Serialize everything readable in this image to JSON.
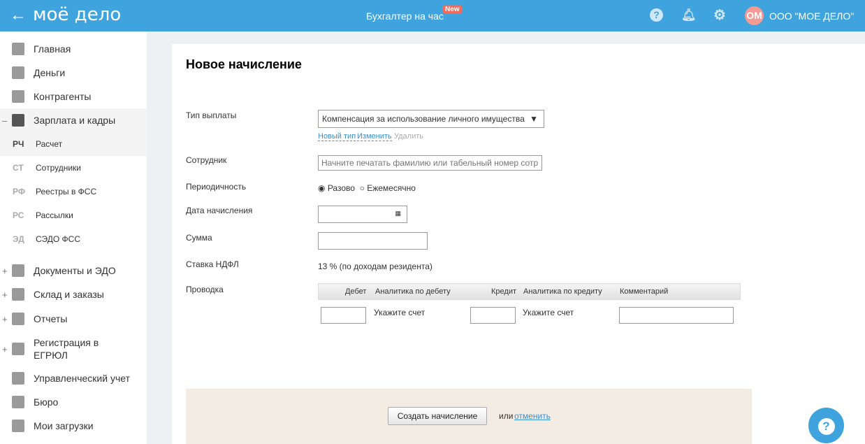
{
  "header": {
    "back": "←",
    "logo": "моё дело",
    "center_link": "Бухгалтер на час",
    "new_badge": "New",
    "avatar": "ОМ",
    "org": "ООО \"МОЕ ДЕЛО\""
  },
  "sidebar": {
    "items": [
      {
        "label": "Главная"
      },
      {
        "label": "Деньги"
      },
      {
        "label": "Контрагенты"
      },
      {
        "label": "Зарплата и кадры",
        "toggle": "–"
      }
    ],
    "sub": [
      {
        "abbr": "РЧ",
        "label": "Расчет"
      },
      {
        "abbr": "СТ",
        "label": "Сотрудники"
      },
      {
        "abbr": "РФ",
        "label": "Реестры в ФСС"
      },
      {
        "abbr": "РС",
        "label": "Рассылки"
      },
      {
        "abbr": "ЭД",
        "label": "СЭДО ФСС"
      }
    ],
    "items2": [
      {
        "label": "Документы и ЭДО",
        "toggle": "+"
      },
      {
        "label": "Склад и заказы",
        "toggle": "+"
      },
      {
        "label": "Отчеты",
        "toggle": "+"
      },
      {
        "label": "Регистрация в ЕГРЮЛ",
        "toggle": "+"
      },
      {
        "label": "Управленческий учет"
      },
      {
        "label": "Бюро"
      },
      {
        "label": "Мои загрузки"
      }
    ]
  },
  "form": {
    "title": "Новое начисление",
    "payment_type_label": "Тип выплаты",
    "payment_type_value": "Компенсация за использование личного имущества",
    "new_type": "Новый тип",
    "edit": "Изменить",
    "delete": "Удалить",
    "employee_label": "Сотрудник",
    "employee_placeholder": "Начните печатать фамилию или табельный номер сотр",
    "period_label": "Периодичность",
    "period_once": "Разово",
    "period_monthly": "Ежемесячно",
    "date_label": "Дата начисления",
    "sum_label": "Сумма",
    "ndfl_label": "Ставка НДФЛ",
    "ndfl_value": "13 % (по доходам резидента)",
    "posting_label": "Проводка",
    "cols": {
      "debit": "Дебет",
      "debit_an": "Аналитика по дебету",
      "credit": "Кредит",
      "credit_an": "Аналитика по кредиту",
      "comment": "Комментарий"
    },
    "debit_hint": "Укажите счет",
    "credit_hint": "Укажите счет",
    "create": "Создать начисление",
    "or": "или",
    "cancel": "отменить"
  },
  "help": "?"
}
